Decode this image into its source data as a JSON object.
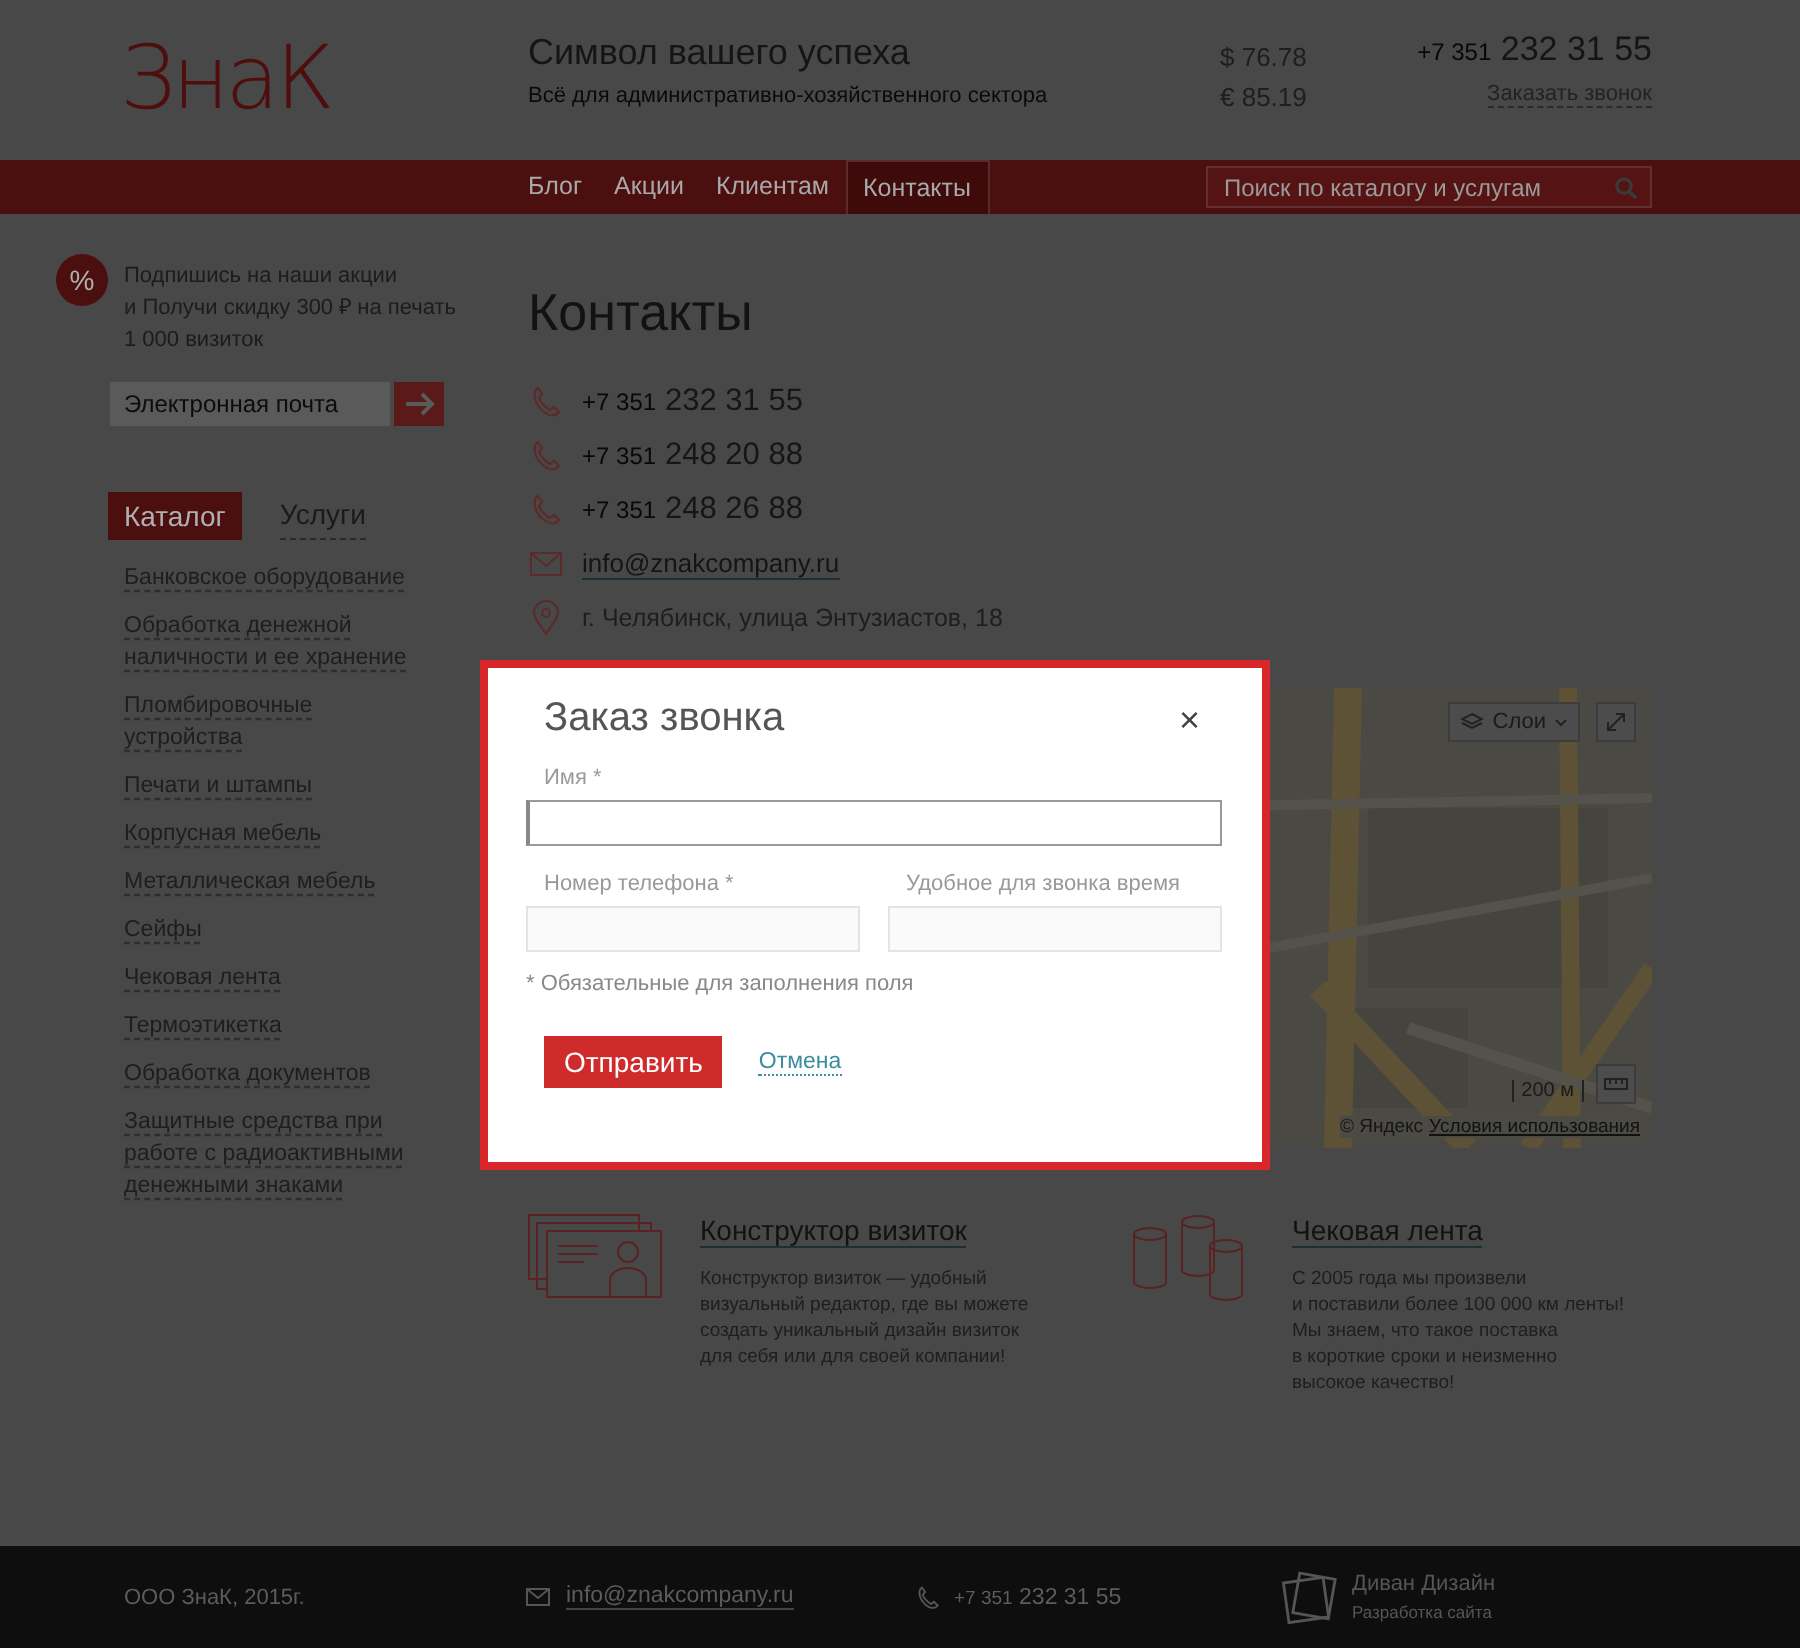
{
  "header": {
    "logo": "ЗнаК",
    "slogan": "Символ вашего успеха",
    "subtitle": "Всё для административно-хозяйственного сектора",
    "rates": [
      "$ 76.78",
      "€ 85.19"
    ],
    "phone_code": "+7 351",
    "phone": "232 31 55",
    "callback_link": "Заказать звонок"
  },
  "nav": [
    {
      "label": "Блог",
      "selected": false
    },
    {
      "label": "Акции",
      "selected": false
    },
    {
      "label": "Клиентам",
      "selected": false
    },
    {
      "label": "Контакты",
      "selected": true
    }
  ],
  "search": {
    "placeholder": "Поиск по каталогу и услугам"
  },
  "promo": {
    "badge": "%",
    "text": "Подпишись на наши акции\nи Получи скидку 300 ₽ на печать\n1 000 визиток",
    "email_placeholder": "Электронная почта"
  },
  "sidebar_tabs": [
    {
      "label": "Каталог",
      "selected": true
    },
    {
      "label": "Услуги",
      "selected": false
    }
  ],
  "catalog": [
    "Банковское оборудование",
    "Обработка денежной наличности и ее хранение",
    "Пломбировочные устройства",
    "Печати и штампы",
    "Корпусная мебель",
    "Металлическая мебель",
    "Сейфы",
    "Чековая лента",
    "Термоэтикетка",
    "Обработка документов",
    "Защитные средства при работе с радиоактивными денежными знаками"
  ],
  "page_title": "Контакты",
  "contacts": [
    {
      "kind": "phone",
      "code": "+7 351",
      "text": "232 31 55"
    },
    {
      "kind": "phone",
      "code": "+7 351",
      "text": "248 20 88"
    },
    {
      "kind": "phone",
      "code": "+7 351",
      "text": "248 26 88"
    },
    {
      "kind": "email",
      "text": "info@znakcompany.ru"
    },
    {
      "kind": "address",
      "text": "г. Челябинск, улица Энтузиастов, 18"
    }
  ],
  "map": {
    "kind": "picture",
    "layers_button": "Слои",
    "scale": "200 м",
    "copyright": "© Яндекс",
    "terms_link": "Условия использования"
  },
  "features": [
    {
      "kind": "cards",
      "title": "Конструктор визиток",
      "text": "Конструктор визиток — удобный\nвизуальный редактор, где вы можете\nсоздать уникальный дизайн визиток\nдля себя или для своей компании!"
    },
    {
      "kind": "rolls",
      "title": "Чековая лента",
      "text": "С 2005 года мы произвели\nи поставили более 100 000 км ленты!\nМы знаем, что такое поставка\nв короткие сроки и неизменно\nвысокое качество!"
    }
  ],
  "footer": {
    "company": "ООО ЗнаК, 2015г.",
    "email": "info@znakcompany.ru",
    "phone_code": "+7 351",
    "phone": "232 31 55",
    "developer": "Диван Дизайн",
    "developer_note": "Разработка сайта"
  },
  "modal": {
    "title": "Заказ звонка",
    "close": "×",
    "fields": [
      {
        "label": "Имя *",
        "focused": true
      },
      {
        "label": "Номер телефона *",
        "focused": false
      },
      {
        "label": "Удобное для звонка время",
        "focused": false
      }
    ],
    "note": "* Обязательные для заполнения поля",
    "submit": "Отправить",
    "cancel": "Отмена"
  }
}
